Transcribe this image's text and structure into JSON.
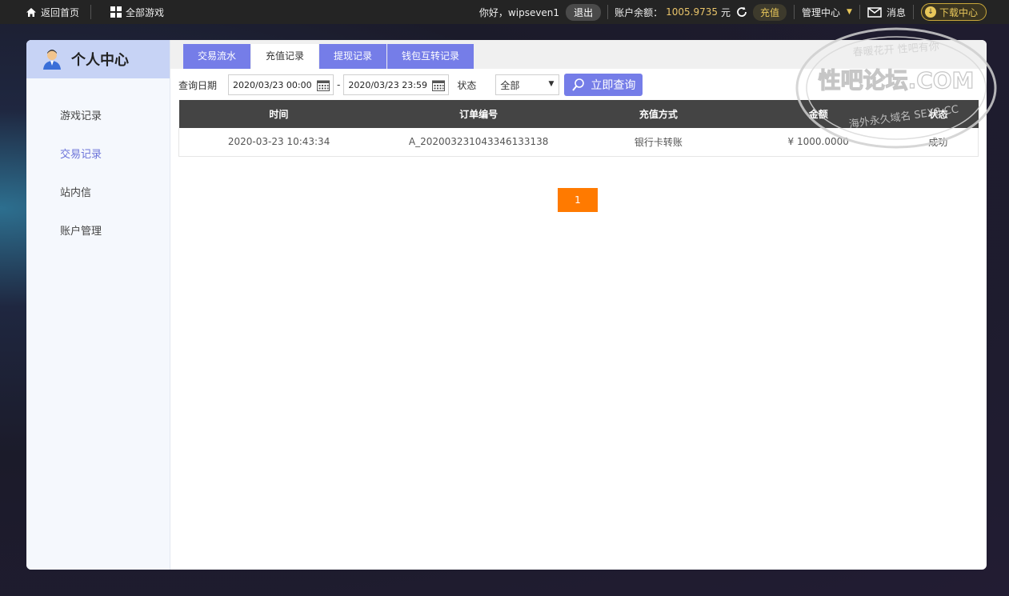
{
  "topbar": {
    "home_label": "返回首页",
    "all_games_label": "全部游戏",
    "greeting": "你好，wipseven1",
    "logout_label": "退出",
    "balance_label": "账户余额：",
    "balance_value": "1005.9735",
    "balance_unit": "元",
    "recharge_label": "充值",
    "manage_label": "管理中心",
    "message_label": "消息",
    "download_label": "下载中心"
  },
  "sidebar": {
    "title": "个人中心",
    "items": [
      {
        "label": "游戏记录"
      },
      {
        "label": "交易记录"
      },
      {
        "label": "站内信"
      },
      {
        "label": "账户管理"
      }
    ],
    "active_index": 1
  },
  "tabs": [
    {
      "label": "交易流水"
    },
    {
      "label": "充值记录"
    },
    {
      "label": "提现记录"
    },
    {
      "label": "钱包互转记录"
    }
  ],
  "active_tab": 1,
  "filter": {
    "date_label": "查询日期",
    "start_date": "2020/03/23 00:00",
    "end_date": "2020/03/23 23:59",
    "separator": "-",
    "status_label": "状态",
    "status_value": "全部",
    "query_label": "立即查询"
  },
  "table": {
    "headers": [
      "时间",
      "订单编号",
      "充值方式",
      "金额",
      "状态"
    ],
    "rows": [
      [
        "2020-03-23 10:43:34",
        "A_20200323104334613313 8",
        "银行卡转账",
        "¥ 1000.0000",
        "成功"
      ]
    ]
  },
  "pager": {
    "current": "1"
  },
  "watermark": {
    "text_main": "性吧论坛.COM",
    "text_top": "春暖花开 性吧有你",
    "text_bottom": "海外永久域名 SEX8.CC"
  },
  "colors": {
    "accent": "#757de8",
    "pager": "#ff7a00",
    "topbar": "#242424",
    "table_header": "#444444",
    "balance": "#e9c46a"
  }
}
